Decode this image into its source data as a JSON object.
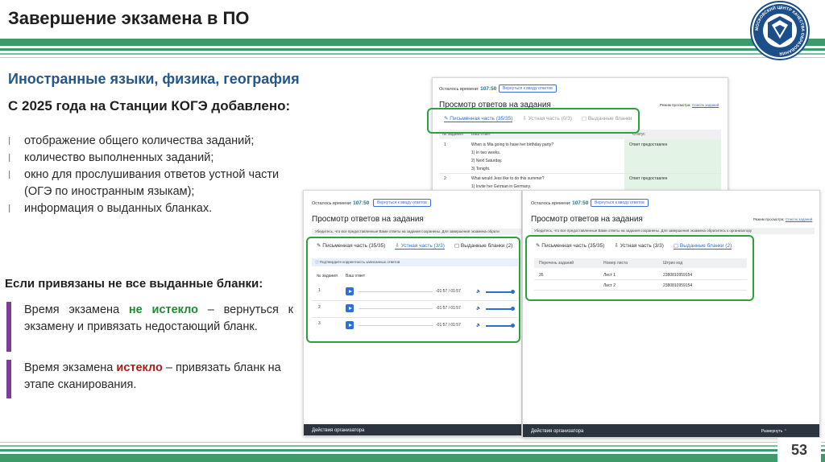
{
  "slide": {
    "title": "Завершение экзамена в ПО",
    "page_number": "53",
    "subtitle": "Иностранные языки, физика, география",
    "lead": "С 2025 года на Станции КОГЭ добавлено:",
    "bullets": [
      "отображение общего количества заданий;",
      "количество выполненных заданий;",
      "окно для прослушивания ответов устной части",
      "(ОГЭ по иностранным языкам);",
      "информация о выданных бланках."
    ],
    "section2": "Если привязаны не все выданные бланки:",
    "note1": {
      "pre": "Время экзамена ",
      "em": "не истекло",
      "post": " – вернуться к экзамену и привязать недостающий бланк."
    },
    "note2": {
      "pre": "Время экзамена ",
      "em": "истекло",
      "post": " – привязать бланк на этапе сканирования."
    }
  },
  "logo": {
    "text": "МОСКОВСКИЙ ЦЕНТР КАЧЕСТВА ОБРАЗОВАНИЯ"
  },
  "colors": {
    "accent_blue": "#24588d",
    "stripe_green": "#3d9a6a",
    "highlight_green": "#2aa43a",
    "purple_bar": "#7d3c98"
  },
  "screen_back": {
    "time_label": "Осталось времени:",
    "time_value": "107:50",
    "return_button": "Вернуться к вводу ответов",
    "heading": "Просмотр ответов на задания",
    "view_mode_label": "Режим просмотра:",
    "view_mode_value": "Список заданий",
    "tabs": [
      "Письменная часть (35/35)",
      "Устная часть (0/3)",
      "Выданные бланки"
    ],
    "col_task": "№ задания",
    "col_answer": "Ваш ответ",
    "col_status": "Статус",
    "rows": [
      {
        "num": "1",
        "question": "When is Mia going to have her birthday party?",
        "options": [
          "1) In two weeks.",
          "2) Next Saturday.",
          "3) Tonight."
        ],
        "status": "Ответ предоставлен"
      },
      {
        "num": "2",
        "question": "What would Jess like to do this summer?",
        "options": [
          "1) Invite her German in Germany."
        ],
        "status": "Ответ предоставлен"
      }
    ]
  },
  "screen_left": {
    "time_label": "Осталось времени:",
    "time_value": "107:50",
    "return_button": "Вернуться к вводу ответов",
    "heading": "Просмотр ответов на задания",
    "info": "Убедитесь, что все предоставленные Вами ответы на задания сохранены. Для завершения экзамена обрати",
    "tabs": [
      "Письменная часть (35/35)",
      "Устная часть (3/3)",
      "Выданные бланки (2)"
    ],
    "confirm": "Подтвердите корректность записанных ответов",
    "col_task": "№ задания",
    "col_answer": "Ваш ответ",
    "audio": [
      {
        "num": "1",
        "time": "-01:57 / 01:57"
      },
      {
        "num": "2",
        "time": "-01:57 / 01:57"
      },
      {
        "num": "3",
        "time": "-01:57 / 01:57"
      }
    ],
    "footer": "Действия организатора"
  },
  "screen_right": {
    "time_label": "Осталось времени:",
    "time_value": "107:50",
    "return_button": "Вернуться к вводу ответов",
    "heading": "Просмотр ответов на задания",
    "view_mode_label": "Режим просмотра:",
    "view_mode_value": "Список заданий",
    "info": "Убедитесь, что все предоставленные Вами ответы на задания сохранены. Для завершения экзамена обратитесь к организатору",
    "tabs": [
      "Письменная часть (35/35)",
      "Устная часть (3/3)",
      "Выданные бланки (2)"
    ],
    "col1": "Перечень заданий",
    "col2": "Номер листа",
    "col3": "Штрих код",
    "rows": [
      {
        "tasks": "35",
        "sheet": "Лист 1",
        "barcode": "2380810959154"
      },
      {
        "tasks": "",
        "sheet": "Лист 2",
        "barcode": "2380810959154"
      }
    ],
    "footer": "Действия организатора",
    "expand": "Развернуть"
  }
}
